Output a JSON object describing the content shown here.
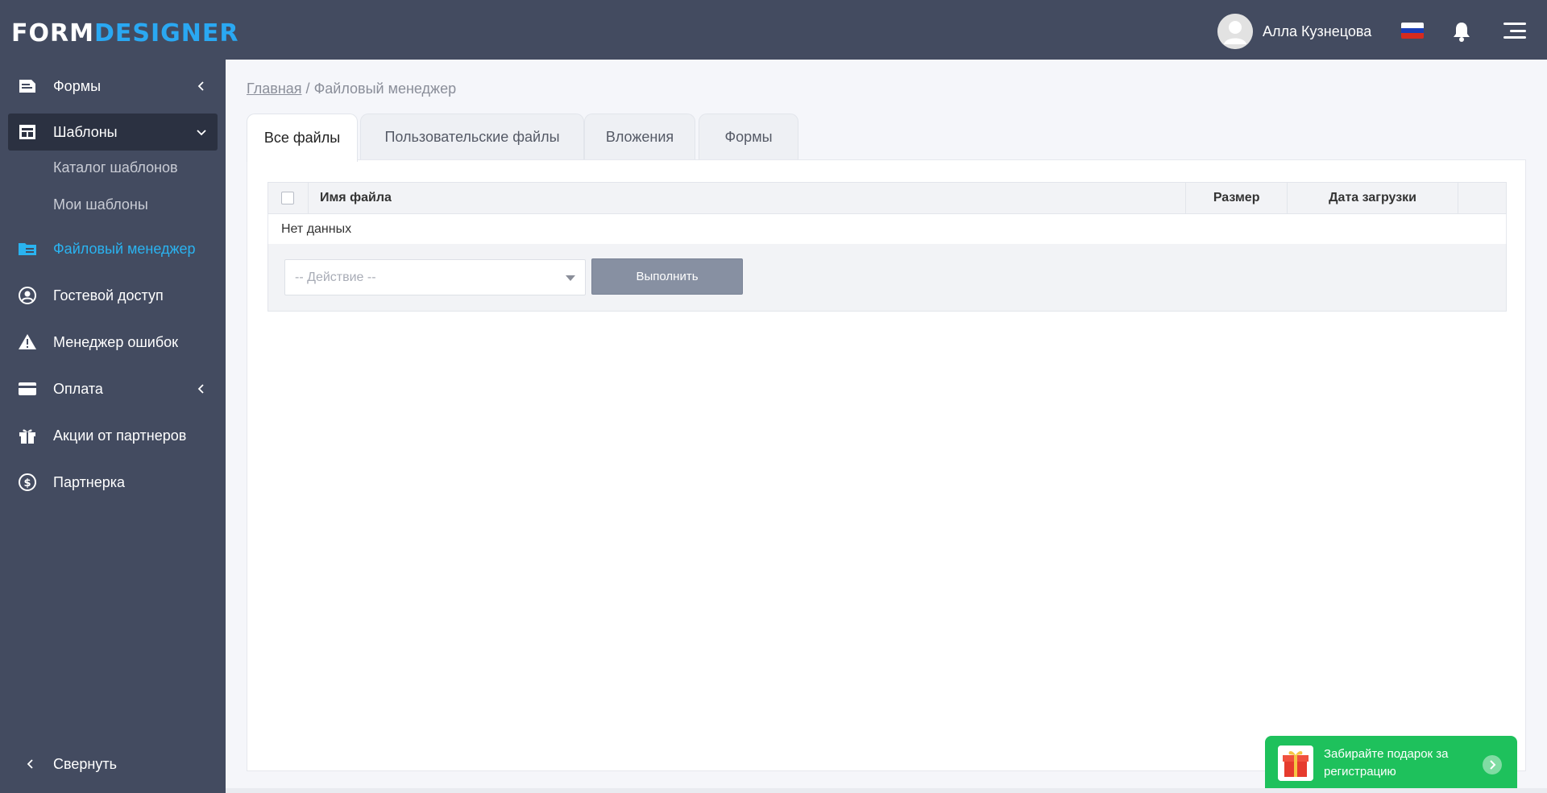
{
  "header": {
    "logo_part1": "FORM",
    "logo_part2": "DESIGNER",
    "user_name": "Алла Кузнецова",
    "language": "ru"
  },
  "sidebar": {
    "items": [
      {
        "label": "Формы",
        "icon": "form-icon",
        "state": "collapsed"
      },
      {
        "label": "Шаблоны",
        "icon": "template-icon",
        "state": "open"
      },
      {
        "label": "Файловый менеджер",
        "icon": "folder-icon",
        "state": "active"
      },
      {
        "label": "Гостевой доступ",
        "icon": "user-circle-icon"
      },
      {
        "label": "Менеджер ошибок",
        "icon": "warning-icon"
      },
      {
        "label": "Оплата",
        "icon": "card-icon",
        "state": "collapsed"
      },
      {
        "label": "Акции от партнеров",
        "icon": "gift-icon"
      },
      {
        "label": "Партнерка",
        "icon": "dollar-icon"
      }
    ],
    "templates_sub": [
      "Каталог шаблонов",
      "Мои шаблоны"
    ],
    "collapse_label": "Свернуть"
  },
  "breadcrumb": {
    "home": "Главная",
    "separator": "/",
    "current": "Файловый менеджер"
  },
  "tabs": [
    {
      "label": "Все файлы",
      "active": true
    },
    {
      "label": "Пользовательские файлы",
      "active": false
    },
    {
      "label": "Вложения",
      "active": false
    },
    {
      "label": "Формы",
      "active": false
    }
  ],
  "table": {
    "columns": [
      "Имя файла",
      "Размер",
      "Дата загрузки"
    ],
    "empty_text": "Нет данных"
  },
  "actions": {
    "select_placeholder": "-- Действие --",
    "run_label": "Выполнить"
  },
  "promo": {
    "text": "Забирайте подарок за регистрацию"
  },
  "colors": {
    "sidebar_bg": "#434b60",
    "accent_blue": "#2ab3f0",
    "promo_green": "#1ec15c",
    "button_gray": "#8790a2"
  }
}
